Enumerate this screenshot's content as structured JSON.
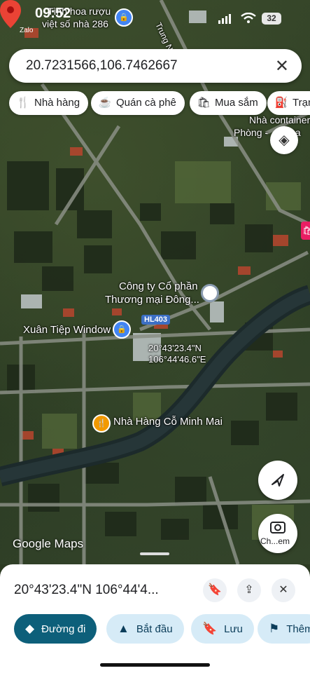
{
  "status_bar": {
    "time": "09:52",
    "notification_app": "Zalo",
    "battery": "32"
  },
  "search": {
    "query": "20.7231566,106.7462667",
    "clear_icon": "close-icon"
  },
  "chips": [
    {
      "icon": "restaurant-icon",
      "label": "Nhà hàng"
    },
    {
      "icon": "coffee-icon",
      "label": "Quán cà phê"
    },
    {
      "icon": "shopping-bag-icon",
      "label": "Mua sắm"
    },
    {
      "icon": "gas-station-icon",
      "label": "Trạm"
    }
  ],
  "map_labels": {
    "top_poi_line1": "Tình hoa rượu",
    "top_poi_line2": "việt số nhà 286",
    "street": "Trung N",
    "container_line1": "Nhà container",
    "container_line2": "Phòng - ... ama",
    "company_line1": "Công ty Cổ phần",
    "company_line2": "Thương mại Đông...",
    "xuan_tiep": "Xuân Tiệp Window",
    "road_shield": "HL403",
    "pin_coord_line1": "20°43'23.4\"N",
    "pin_coord_line2": "106°44'46.6\"E",
    "restaurant": "Nhà Hàng Cỗ Minh Mai",
    "attribution": "Google Maps",
    "search_area_label": "Ch...em"
  },
  "sheet": {
    "title": "20°43'23.4\"N 106°44'4...",
    "actions": [
      {
        "icon": "directions-icon",
        "label": "Đường đi"
      },
      {
        "icon": "navigation-arrow-icon",
        "label": "Bắt đầu"
      },
      {
        "icon": "bookmark-icon",
        "label": "Lưu"
      },
      {
        "icon": "flag-icon",
        "label": "Thêm"
      }
    ]
  },
  "colors": {
    "primary_action": "#0d5f7a",
    "secondary_action": "#d6ebf7",
    "pin": "#ea4335",
    "poi_blue": "#4285f4",
    "poi_orange": "#f29900"
  }
}
